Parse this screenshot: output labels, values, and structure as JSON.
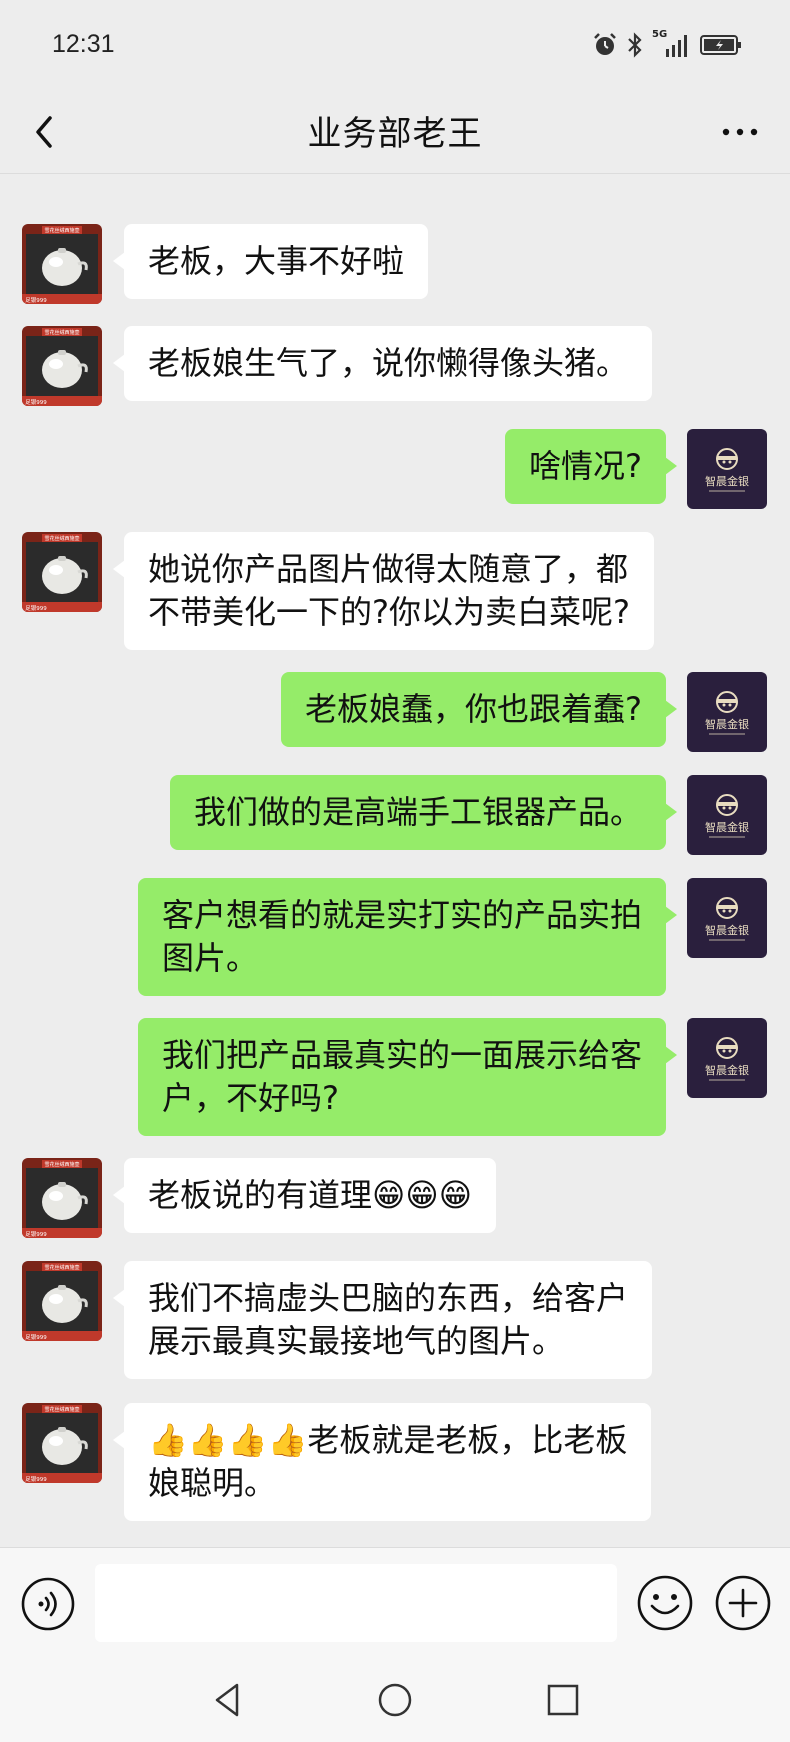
{
  "status_bar": {
    "time": "12:31",
    "network_label": "5G"
  },
  "header": {
    "title": "业务部老王"
  },
  "messages": [
    {
      "sender": "them",
      "text": "老板，大事不好啦"
    },
    {
      "sender": "them",
      "text": "老板娘生气了，说你懒得像头猪。"
    },
    {
      "sender": "me",
      "text": "啥情况?"
    },
    {
      "sender": "them",
      "text": "她说你产品图片做得太随意了，都\n不带美化一下的?你以为卖白菜呢?"
    },
    {
      "sender": "me",
      "text": "老板娘蠢，你也跟着蠢?"
    },
    {
      "sender": "me",
      "text": "我们做的是高端手工银器产品。"
    },
    {
      "sender": "me",
      "text": "客户想看的就是实打实的产品实拍\n图片。"
    },
    {
      "sender": "me",
      "text": "我们把产品最真实的一面展示给客\n户，不好吗?"
    },
    {
      "sender": "them",
      "text": "老板说的有道理😁😁😁"
    },
    {
      "sender": "them",
      "text": "我们不搞虚头巴脑的东西，给客户\n展示最真实最接地气的图片。"
    },
    {
      "sender": "them",
      "text": "👍👍👍👍老板就是老板，比老板\n娘聪明。"
    }
  ],
  "avatars": {
    "them_label_top": "雪花丝绒西施壶",
    "them_label_bottom": "足银999",
    "me_brand": "智晨金银"
  },
  "input": {
    "value": "",
    "placeholder": ""
  },
  "colors": {
    "background": "#ededed",
    "my_bubble": "#95ec69",
    "their_bubble": "#ffffff"
  }
}
